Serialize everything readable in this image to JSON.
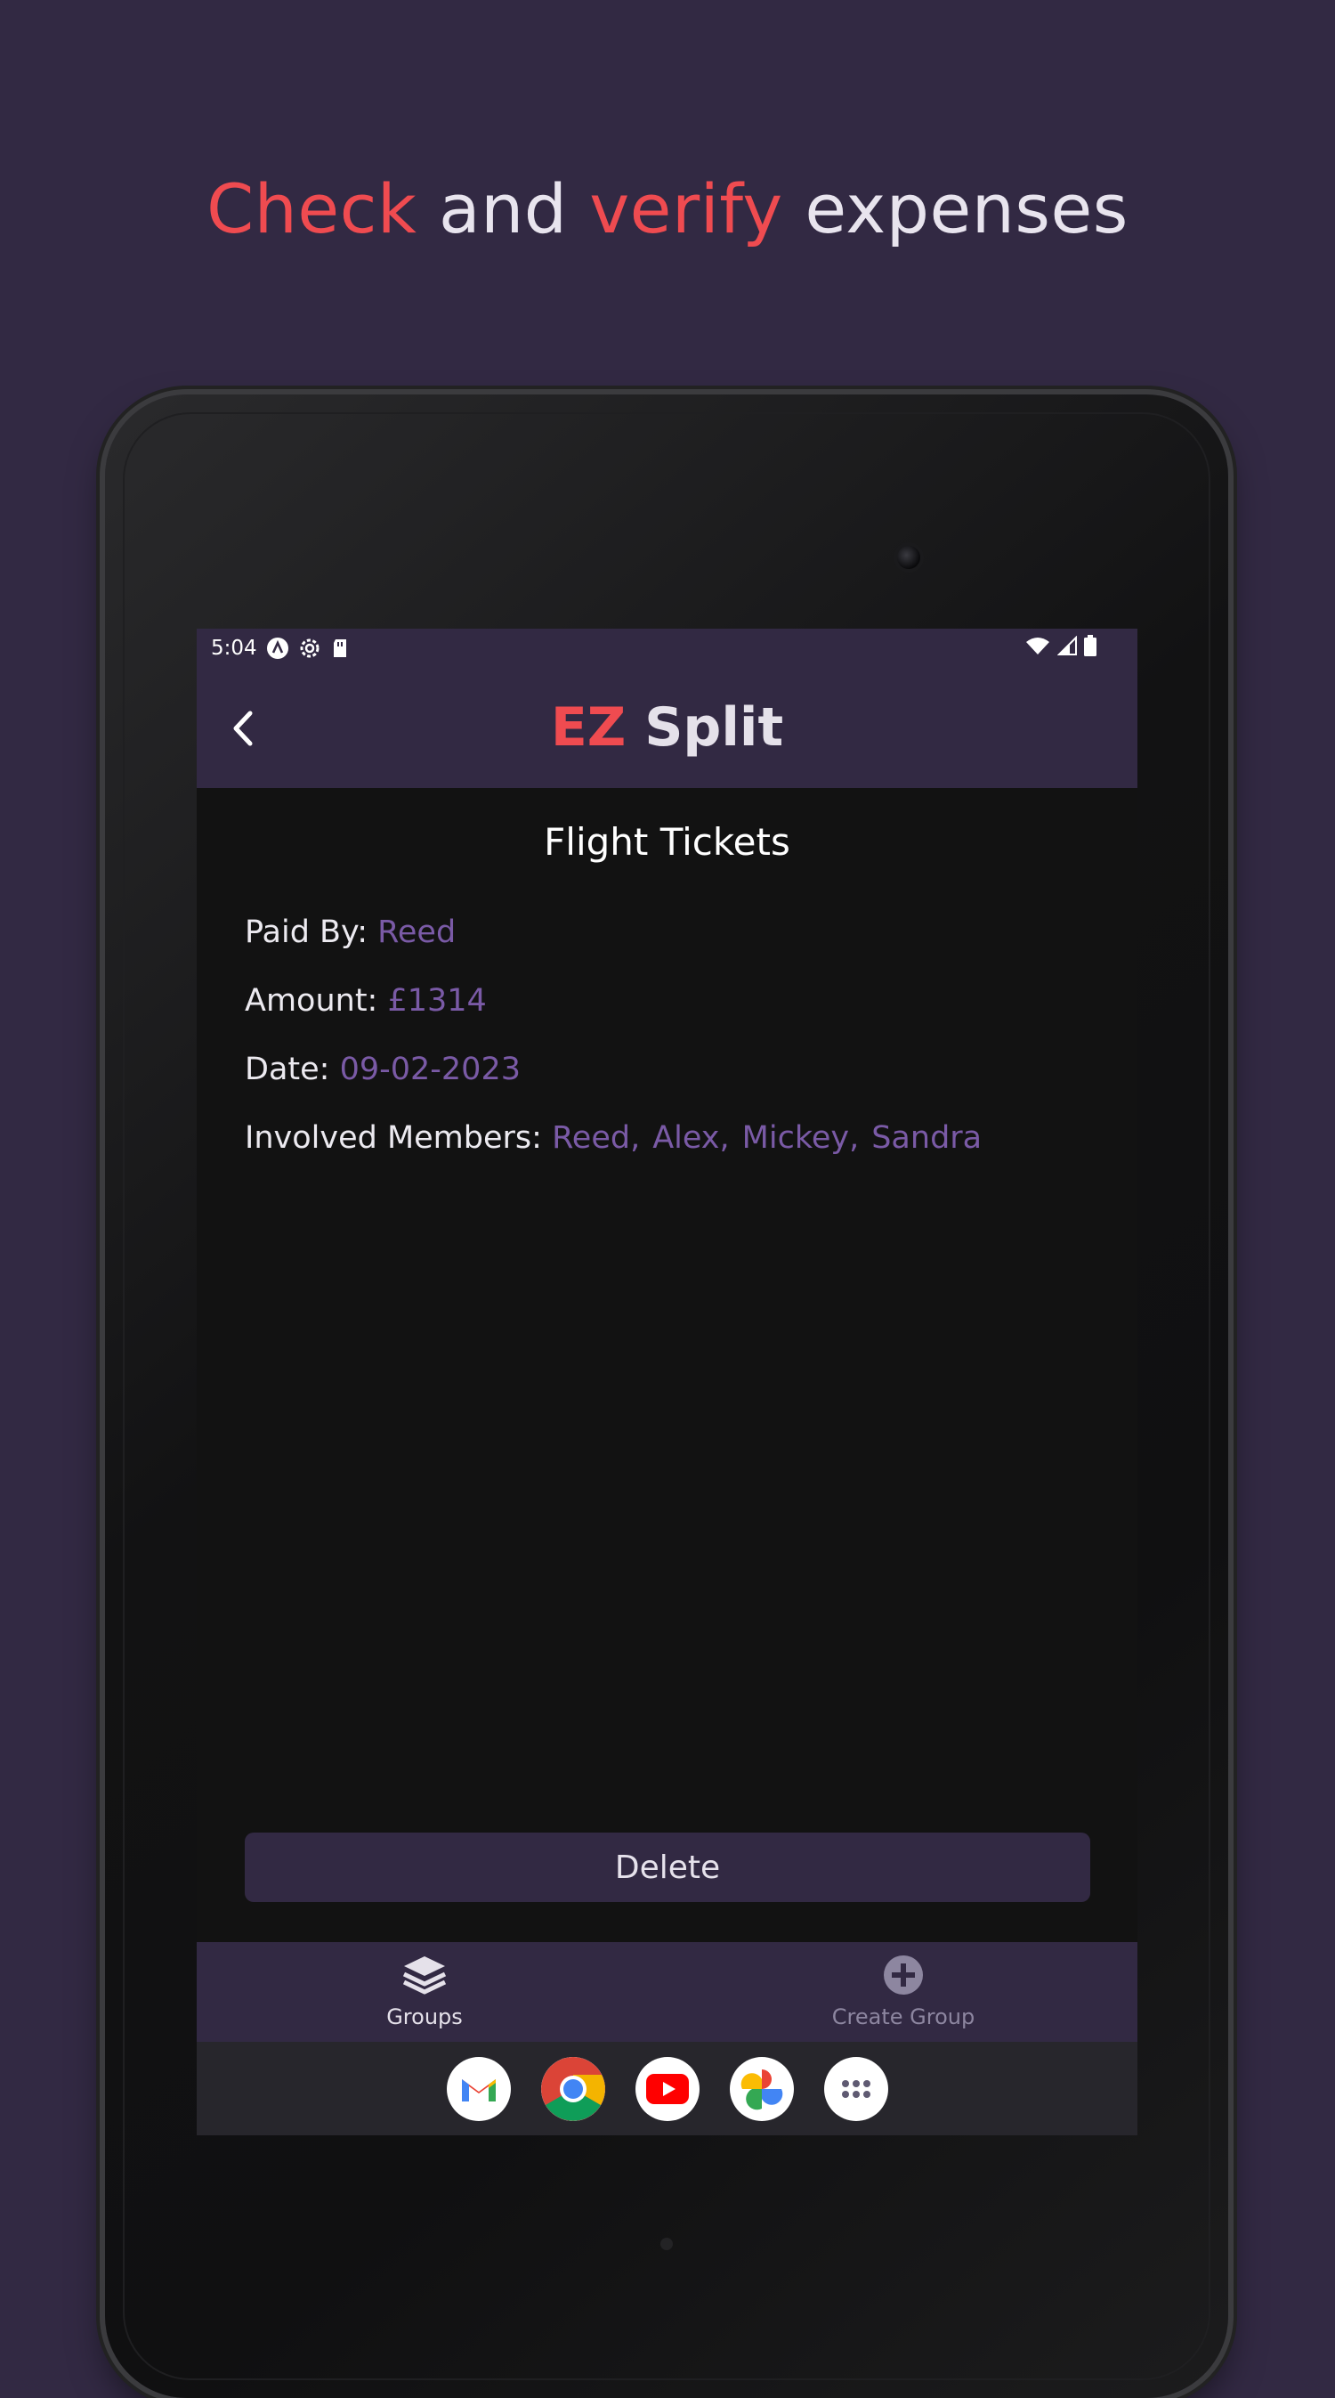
{
  "headline": {
    "word1": "Check",
    "word2": " and ",
    "word3": "verify",
    "word4": " expenses"
  },
  "status_bar": {
    "time": "5:04"
  },
  "app_bar": {
    "brand_accent": "EZ",
    "brand_rest": " Split"
  },
  "expense": {
    "title": "Flight Tickets",
    "paid_by_label": "Paid By: ",
    "paid_by_value": "Reed",
    "amount_label": "Amount: ",
    "amount_value": "£1314",
    "date_label": "Date: ",
    "date_value": "09-02-2023",
    "members_label": "Involved Members: ",
    "members": [
      "Reed,",
      "Alex,",
      "Mickey,",
      "Sandra"
    ]
  },
  "actions": {
    "delete_label": "Delete"
  },
  "bottom_nav": {
    "groups_label": "Groups",
    "create_group_label": "Create Group"
  },
  "dock": {
    "apps": [
      "gmail-icon",
      "chrome-icon",
      "youtube-icon",
      "photos-icon",
      "app-drawer-icon"
    ]
  },
  "colors": {
    "background": "#322943",
    "accent_red": "#ef4b50",
    "value_purple": "#7a5aa6",
    "screen_bg": "#121212"
  }
}
